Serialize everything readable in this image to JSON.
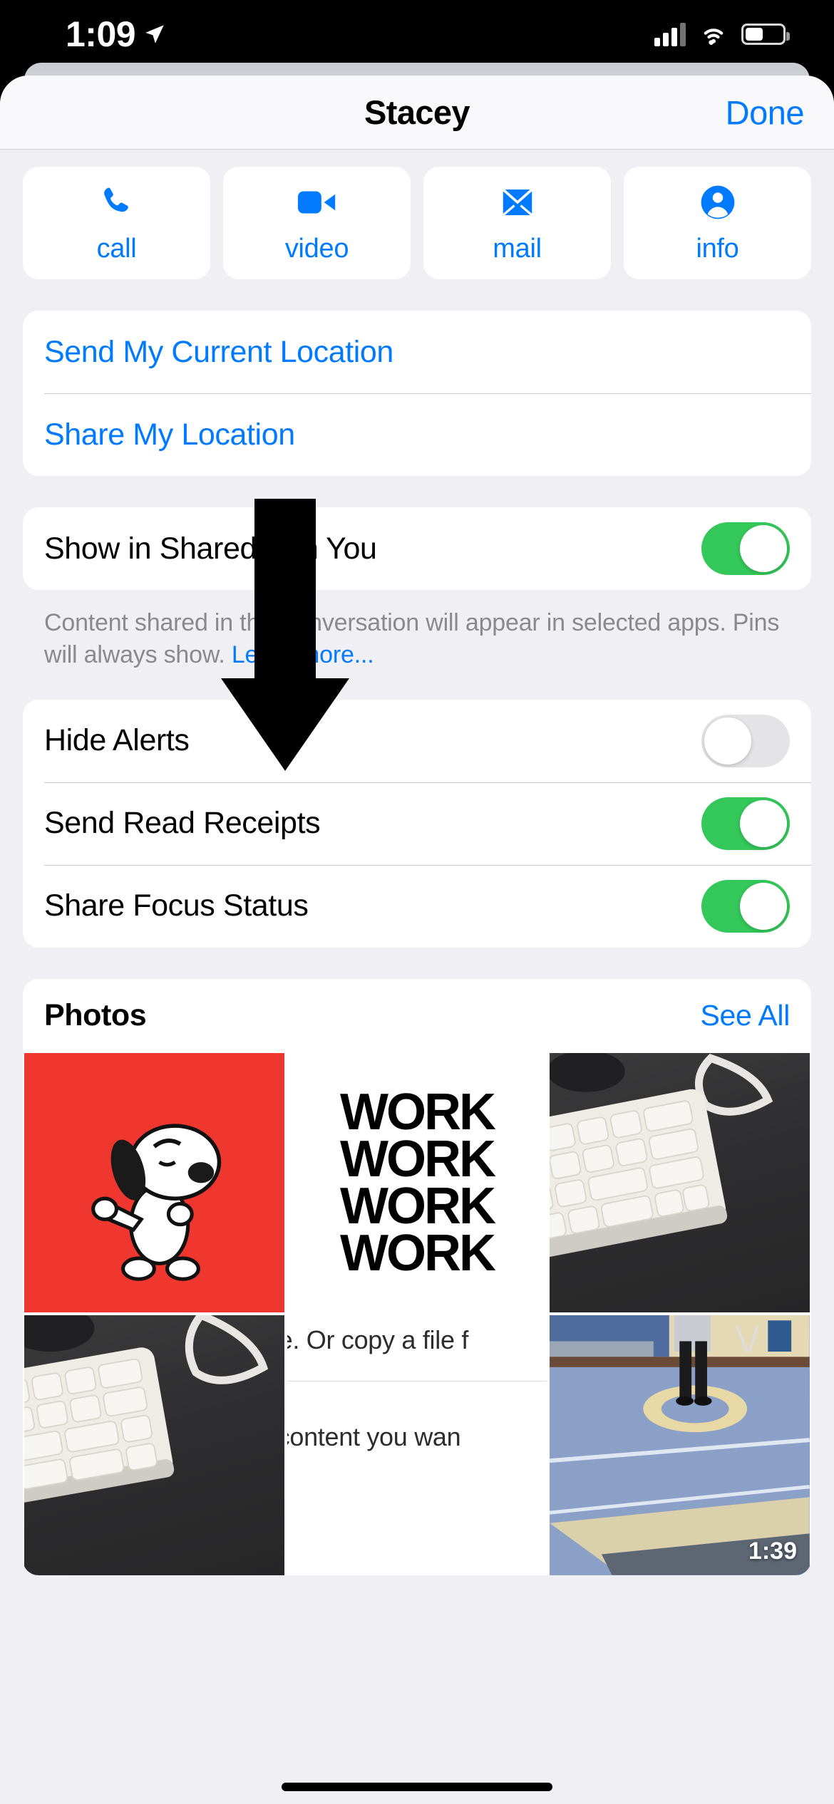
{
  "status_bar": {
    "time": "1:09",
    "location_icon": "location-arrow-icon",
    "cellular_icon": "cellular-bars-icon",
    "wifi_icon": "wifi-icon",
    "battery_icon": "battery-icon"
  },
  "nav": {
    "title": "Stacey",
    "done_label": "Done"
  },
  "quick_actions": [
    {
      "label": "call",
      "icon": "phone-icon"
    },
    {
      "label": "video",
      "icon": "video-camera-icon"
    },
    {
      "label": "mail",
      "icon": "envelope-icon"
    },
    {
      "label": "info",
      "icon": "person-circle-icon"
    }
  ],
  "location_group": {
    "send_current": "Send My Current Location",
    "share_location": "Share My Location"
  },
  "shared_with_you": {
    "label": "Show in Shared with You",
    "enabled": true,
    "note_text": "Content shared in this conversation will appear in selected apps. Pins will always show. ",
    "note_link": "Learn more..."
  },
  "settings": [
    {
      "label": "Hide Alerts",
      "enabled": false
    },
    {
      "label": "Send Read Receipts",
      "enabled": true
    },
    {
      "label": "Share Focus Status",
      "enabled": true
    }
  ],
  "photos": {
    "title": "Photos",
    "see_all": "See All",
    "items": [
      {
        "kind": "snoopy",
        "alt": "Snoopy dancing on red background"
      },
      {
        "kind": "work",
        "alt": "WORK WORK WORK bold text poster",
        "lines": [
          "WORK",
          "WORK",
          "WORK",
          "WORK"
        ]
      },
      {
        "kind": "keyboard",
        "alt": "White Apple keyboard on dark desk"
      },
      {
        "kind": "keyboard",
        "alt": "White Apple keyboard on dark desk"
      },
      {
        "kind": "document",
        "alt": "Document text screenshot",
        "line1": "e. Or copy a file f",
        "line2": "content you wan"
      },
      {
        "kind": "gym",
        "alt": "Person on blue wrestling mat in gym",
        "duration": "1:39"
      }
    ]
  },
  "colors": {
    "accent": "#007AFF",
    "toggle_on": "#34C759",
    "toggle_off": "#E4E4E7",
    "sheet_bg": "#F0F0F4"
  },
  "annotation": {
    "arrow_icon": "down-arrow-annotation"
  }
}
